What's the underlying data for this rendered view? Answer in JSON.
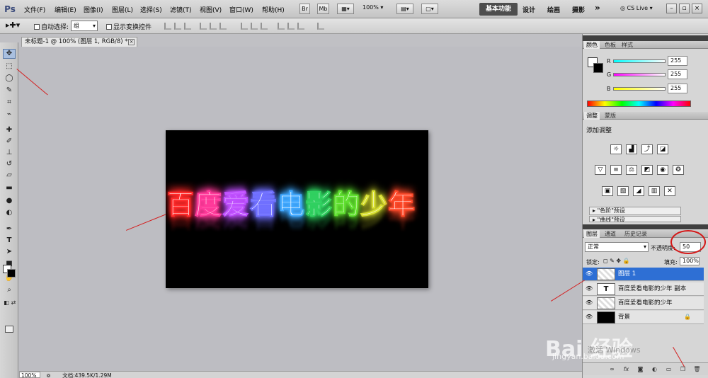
{
  "menubar": {
    "logo": "Ps",
    "items": [
      "文件(F)",
      "编辑(E)",
      "图像(I)",
      "图层(L)",
      "选择(S)",
      "滤镜(T)",
      "视图(V)",
      "窗口(W)",
      "帮助(H)"
    ],
    "zoom": "100%",
    "workspaces": [
      "基本功能",
      "设计",
      "绘画",
      "摄影"
    ],
    "more": "»",
    "cs_live": "CS Live"
  },
  "options": {
    "auto_select_label": "自动选择:",
    "auto_select_value": "组",
    "show_transform_label": "显示变换控件"
  },
  "document": {
    "tab_title": "未标题-1 @ 100% (图层 1, RGB/8) *",
    "canvas_text": [
      "百",
      "度",
      "爱",
      "看",
      "电",
      "影",
      "的",
      "少",
      "年"
    ],
    "char_colors": [
      "#ff2a2a",
      "#ff3a9a",
      "#c050ff",
      "#7070ff",
      "#40a8ff",
      "#30d060",
      "#60e030",
      "#d8e030",
      "#ff4a2a"
    ]
  },
  "status": {
    "zoom": "100%",
    "doc_info": "文档:439.5K/1.29M"
  },
  "color_panel": {
    "tabs": [
      "颜色",
      "色板",
      "样式"
    ],
    "r_label": "R",
    "g_label": "G",
    "b_label": "B",
    "r": "255",
    "g": "255",
    "b": "255"
  },
  "adjust_panel": {
    "tabs": [
      "调整",
      "蒙版"
    ],
    "title": "添加调整",
    "presets": [
      "\"色阶\"预设",
      "\"曲线\"预设"
    ]
  },
  "layers_panel": {
    "tabs": [
      "图层",
      "通道",
      "历史记录"
    ],
    "blend_mode": "正常",
    "opacity_label": "不透明度:",
    "opacity_value": "50",
    "lock_label": "锁定:",
    "fill_label": "填充:",
    "fill_value": "100%",
    "layers": [
      {
        "name": "图层 1",
        "type": "pixel",
        "selected": true
      },
      {
        "name": "百度爱看电影的少年 副本",
        "type": "text",
        "selected": false
      },
      {
        "name": "百度爱看电影的少年",
        "type": "pixel",
        "selected": false
      },
      {
        "name": "背景",
        "type": "background",
        "selected": false
      }
    ]
  },
  "watermark": {
    "brand": "Bai 经验",
    "url": "jingyan.baidu.com",
    "windows": "激活 Windows"
  }
}
